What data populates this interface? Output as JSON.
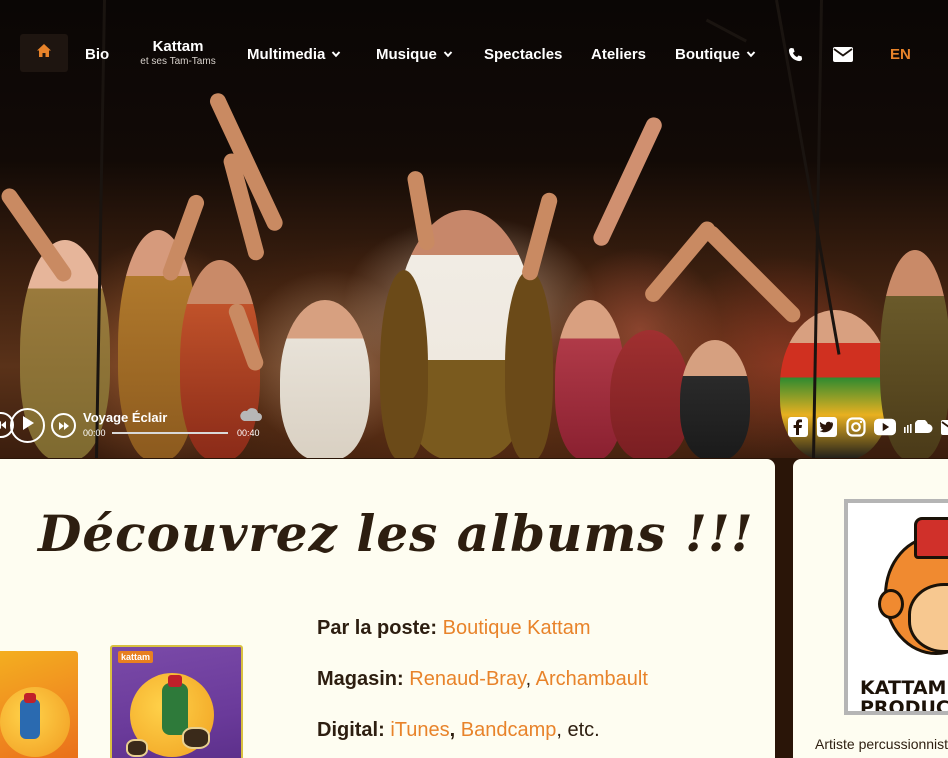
{
  "nav": {
    "home_icon": "home-icon",
    "bio": "Bio",
    "brand_title": "Kattam",
    "brand_subtitle": "et ses Tam-Tams",
    "multimedia": "Multimedia",
    "musique": "Musique",
    "spectacles": "Spectacles",
    "ateliers": "Ateliers",
    "boutique": "Boutique",
    "phone_icon": "phone-icon",
    "mail_icon": "envelope-icon",
    "lang": "EN"
  },
  "player": {
    "title": "Voyage Éclair",
    "time_current": "00:00",
    "time_total": "00:40",
    "progress": 0,
    "icons": [
      "skip-back-icon",
      "play-icon",
      "skip-forward-icon",
      "soundcloud-icon"
    ]
  },
  "social": [
    "facebook-icon",
    "twitter-icon",
    "instagram-icon",
    "youtube-icon",
    "soundcloud-icon",
    "envelope-icon"
  ],
  "main": {
    "headline": "Découvrez les albums !!!",
    "post_label": "Par la poste:",
    "post_link": "Boutique Kattam",
    "store_label": "Magasin:",
    "store_link1": "Renaud-Bray",
    "store_sep": ",",
    "store_link2": "Archambault",
    "digital_label": "Digital:",
    "digital_link1": "iTunes",
    "digital_sep": ",",
    "digital_link2": "Bandcamp",
    "digital_suffix": ", etc.",
    "album1_label": "kattam",
    "album2_label": "kattam"
  },
  "side": {
    "logo_line1": "KATTAM",
    "logo_line2": "PRODUCTIONS",
    "text": "Artiste percussionniste"
  },
  "colors": {
    "accent": "#e8832a",
    "card_bg": "#fefdf1",
    "dark_text": "#2d1e10"
  }
}
